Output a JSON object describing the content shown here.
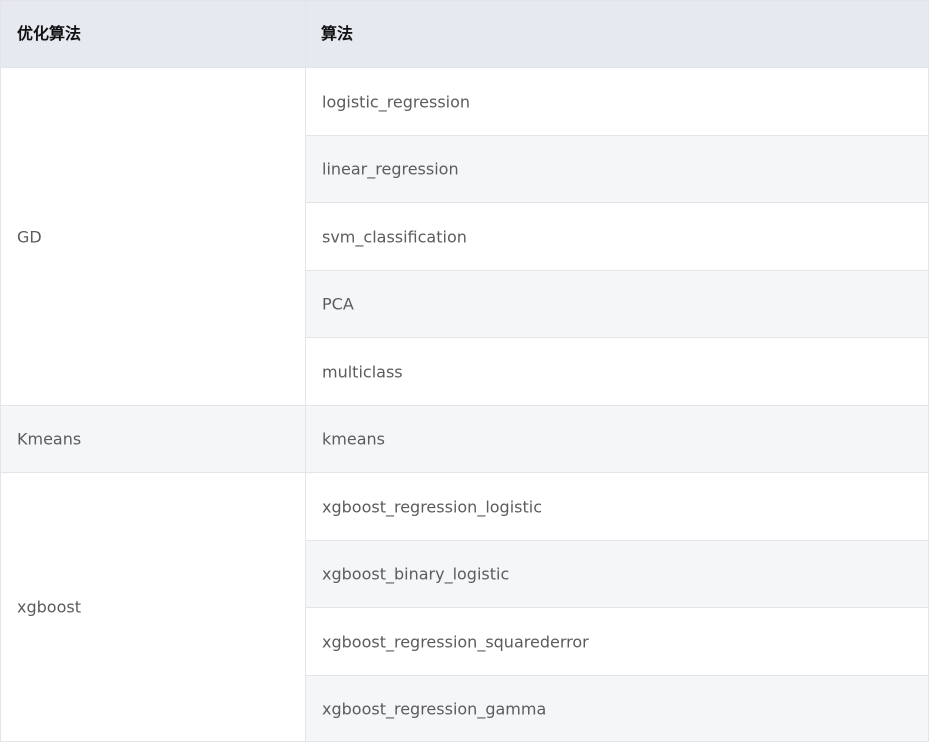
{
  "table": {
    "headers": [
      "优化算法",
      "算法"
    ],
    "groups": [
      {
        "label": "GD",
        "algorithms": [
          "logistic_regression",
          "linear_regression",
          "svm_classification",
          "PCA",
          "multiclass"
        ]
      },
      {
        "label": "Kmeans",
        "algorithms": [
          "kmeans"
        ]
      },
      {
        "label": "xgboost",
        "algorithms": [
          "xgboost_regression_logistic",
          "xgboost_binary_logistic",
          "xgboost_regression_squarederror",
          "xgboost_regression_gamma"
        ]
      }
    ]
  }
}
